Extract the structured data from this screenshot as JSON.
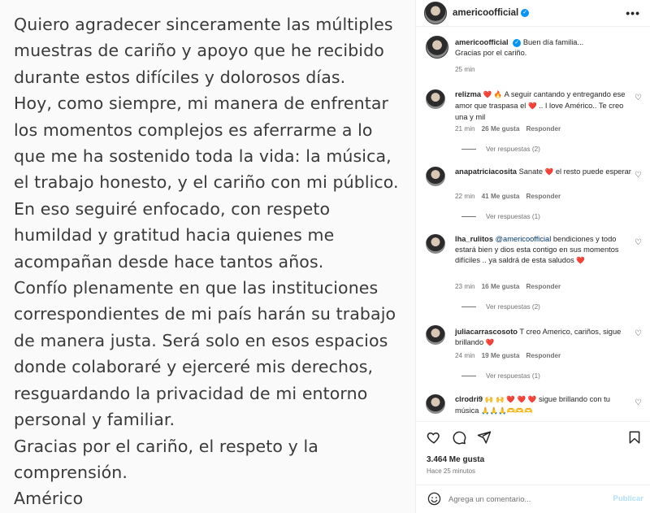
{
  "post_image": {
    "lines": [
      "Quiero agradecer sinceramente las múltiples",
      "muestras de cariño y apoyo que he recibido",
      "durante estos difíciles y dolorosos días.",
      "Hoy, como siempre, mi manera de enfrentar",
      "los momentos complejos es aferrarme a lo",
      "que me ha sostenido toda la vida: la música,",
      "el trabajo honesto, y el cariño con mi público.",
      "En eso seguiré enfocado, con respeto",
      "humildad y gratitud hacia quienes me",
      "acompañan desde hace tantos años.",
      "Confío plenamente en que las instituciones",
      "correspondientes de mi país harán su trabajo",
      "de manera justa. Será solo en esos espacios",
      "donde colaboraré y ejerceré mis derechos,",
      "resguardando la privacidad de mi entorno",
      "personal y familiar.",
      "Gracias por el cariño, el respeto y la",
      "comprensión.",
      "Américo"
    ]
  },
  "header": {
    "username": "americoofficial",
    "verified_icon": "verified-badge-icon",
    "more_label": "•••"
  },
  "caption": {
    "username": "americoofficial",
    "line1": "Buen día familia...",
    "line2": "Gracias por el cariño.",
    "time": "25 min"
  },
  "comments": [
    {
      "username": "relizma",
      "text_parts": [
        "A seguir cantando y entregando ese amor que traspasa el",
        ".. I love Américo.. Te creo una y mil"
      ],
      "emoji_lead": "❤️ 🔥",
      "emoji_mid": "❤️",
      "time": "21 min",
      "likes": "26 Me gusta",
      "reply": "Responder",
      "view_replies": "Ver respuestas (2)"
    },
    {
      "username": "anapatriciacosita",
      "text_parts": [
        "Sanate",
        "el resto puede esperar"
      ],
      "emoji_mid": "❤️",
      "time": "22 min",
      "likes": "41 Me gusta",
      "reply": "Responder",
      "view_replies": "Ver respuestas (1)"
    },
    {
      "username": "lha_rulitos",
      "mention": "@americoofficial",
      "text": "bendiciones y todo estará bien y dios esta contigo en sus momentos difíciles .. ya saldrá de esta saludos",
      "emoji_end": "❤️",
      "time": "23 min",
      "likes": "16 Me gusta",
      "reply": "Responder",
      "view_replies": "Ver respuestas (2)"
    },
    {
      "username": "juliacarrascosoto",
      "text": "T creo Americo, cariños, sigue brillando",
      "emoji_end": "❤️",
      "time": "24 min",
      "likes": "19 Me gusta",
      "reply": "Responder",
      "view_replies": "Ver respuestas (1)"
    },
    {
      "username": "clrodri9",
      "emoji_lead": "🙌 🙌 ❤️ ❤️ ❤️",
      "text": "sigue brillando con tu música",
      "emoji_end": "🙏🙏🙏🫶🫶🫶"
    }
  ],
  "actions": {
    "likes": "3.464 Me gusta",
    "time": "Hace 25 minutos"
  },
  "composer": {
    "placeholder": "Agrega un comentario...",
    "publish": "Publicar"
  },
  "colors": {
    "accent": "#0095f6",
    "publish_disabled": "#b2dffc",
    "heart": "#ed4956",
    "muted": "#737373"
  }
}
